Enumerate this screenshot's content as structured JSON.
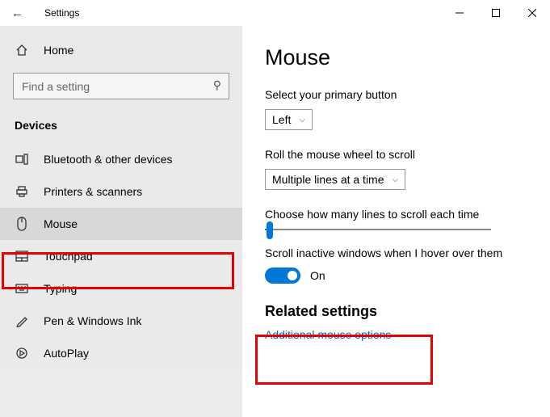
{
  "titlebar": {
    "title": "Settings"
  },
  "sidebar": {
    "home": "Home",
    "search_placeholder": "Find a setting",
    "group": "Devices",
    "items": [
      {
        "label": "Bluetooth & other devices"
      },
      {
        "label": "Printers & scanners"
      },
      {
        "label": "Mouse"
      },
      {
        "label": "Touchpad"
      },
      {
        "label": "Typing"
      },
      {
        "label": "Pen & Windows Ink"
      },
      {
        "label": "AutoPlay"
      }
    ]
  },
  "main": {
    "title": "Mouse",
    "primary_label": "Select your primary button",
    "primary_value": "Left",
    "wheel_label": "Roll the mouse wheel to scroll",
    "wheel_value": "Multiple lines at a time",
    "lines_label": "Choose how many lines to scroll each time",
    "hover_label": "Scroll inactive windows when I hover over them",
    "hover_state": "On",
    "related_title": "Related settings",
    "related_link": "Additional mouse options"
  }
}
